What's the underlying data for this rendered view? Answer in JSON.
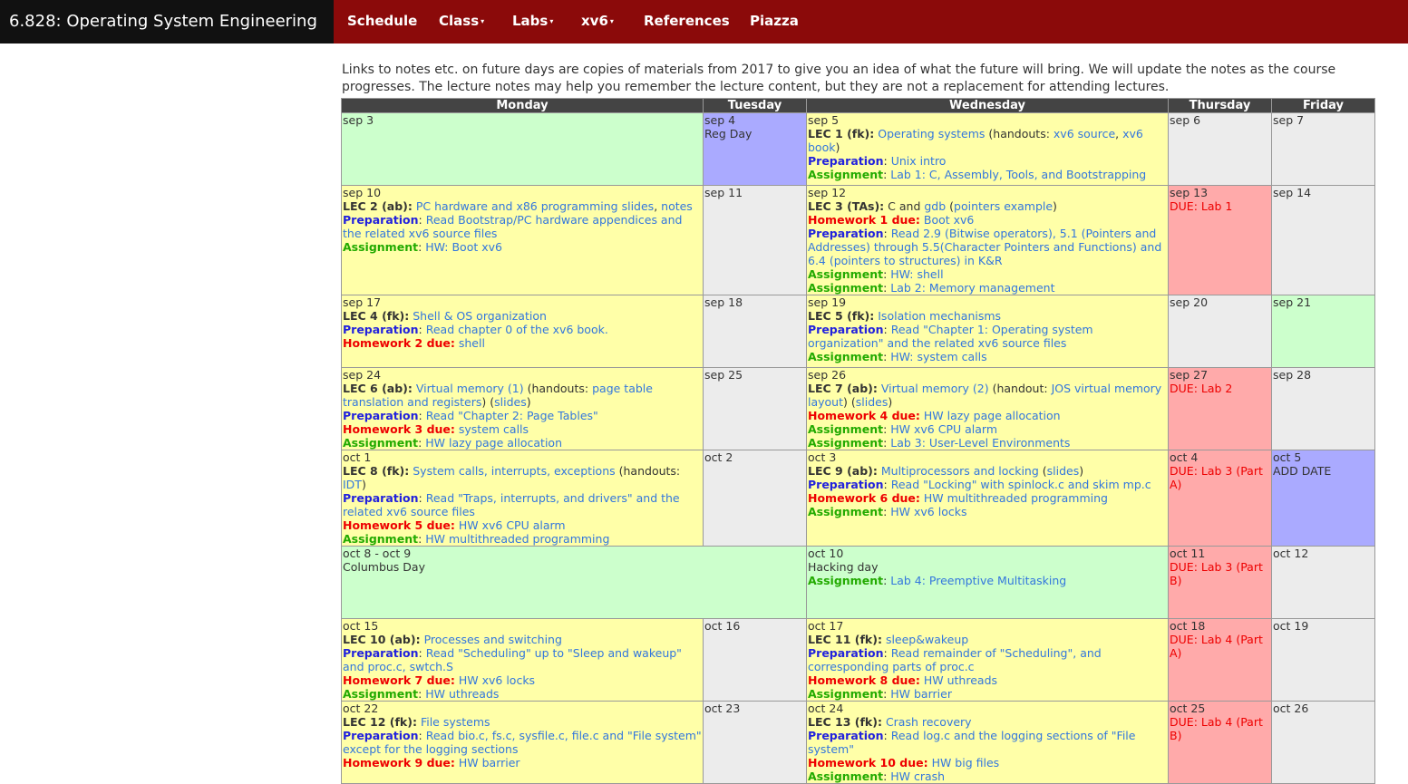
{
  "nav": {
    "brand": "6.828: Operating System Engineering",
    "schedule": "Schedule",
    "class": "Class",
    "labs": "Labs",
    "xv6": "xv6",
    "references": "References",
    "piazza": "Piazza",
    "caret": "▾"
  },
  "intro": "Links to notes etc. on future days are copies of materials from 2017 to give you an idea of what the future will bring. We will update the notes as the course progresses. The lecture notes may help you remember the lecture content, but they are not a replacement for attending lectures.",
  "days": {
    "mon": "Monday",
    "tue": "Tuesday",
    "wed": "Wednesday",
    "thu": "Thursday",
    "fri": "Friday"
  },
  "labels": {
    "preparation": "Preparation",
    "assignment": "Assignment",
    "due": "DUE"
  },
  "colors": {
    "navbar": "#8b0a0a",
    "brand_bg": "#111111",
    "yellow": "#ffffa8",
    "gray": "#ececec",
    "green": "#ccffcc",
    "red": "#ffaaaa",
    "purple": "#aaaaff",
    "link": "#3377dd",
    "prep": "#2222dd",
    "homework": "#ee0000",
    "assignment": "#22aa00"
  },
  "w1": {
    "mon_date": "sep 3",
    "tue_date": "sep 4",
    "tue_note": "Reg Day",
    "wed_date": "sep 5",
    "wed_lec": "LEC 1 (fk):",
    "wed_lec_link": "Operating systems",
    "wed_lec_mid": "(handouts:",
    "wed_lec_link2": "xv6 source",
    "wed_lec_link3": "xv6 book",
    "wed_lec_end": ")",
    "wed_prep": "Unix intro",
    "wed_asg": "Lab 1: C, Assembly, Tools, and Bootstrapping",
    "thu_date": "sep 6",
    "fri_date": "sep 7"
  },
  "w2": {
    "mon_date": "sep 10",
    "mon_lec": "LEC 2 (ab):",
    "mon_lec_link": "PC hardware and x86 programming",
    "mon_lec_link2": "slides",
    "mon_lec_link3": "notes",
    "mon_prep": "Read Bootstrap/PC hardware appendices and the related xv6 source files",
    "mon_asg": "HW: Boot xv6",
    "tue_date": "sep 11",
    "wed_date": "sep 12",
    "wed_lec": "LEC 3 (TAs):",
    "wed_lec_text": "C and",
    "wed_lec_link": "gdb",
    "wed_lec_link2": "pointers example",
    "wed_hw_label": "Homework 1 due:",
    "wed_hw": "Boot xv6",
    "wed_prep": "Read 2.9 (Bitwise operators), 5.1 (Pointers and Addresses) through 5.5(Character Pointers and Functions) and 6.4 (pointers to structures) in K&R",
    "wed_asg": "HW: shell",
    "wed_asg2": "Lab 2: Memory management",
    "thu_date": "sep 13",
    "thu_due": "Lab 1",
    "fri_date": "sep 14"
  },
  "w3": {
    "mon_date": "sep 17",
    "mon_lec": "LEC 4 (fk):",
    "mon_lec_link": "Shell & OS organization",
    "mon_prep": "Read chapter 0 of the xv6 book.",
    "mon_hw_label": "Homework 2 due:",
    "mon_hw": "shell",
    "tue_date": "sep 18",
    "wed_date": "sep 19",
    "wed_lec": "LEC 5 (fk):",
    "wed_lec_link": "Isolation mechanisms",
    "wed_prep": "Read \"Chapter 1: Operating system organization\" and the related xv6 source files",
    "wed_asg": "HW: system calls",
    "thu_date": "sep 20",
    "fri_date": "sep 21"
  },
  "w4": {
    "mon_date": "sep 24",
    "mon_lec": "LEC 6 (ab):",
    "mon_lec_link": "Virtual memory (1)",
    "mon_lec_mid": "(handouts:",
    "mon_lec_link2": "page table translation and registers",
    "mon_lec_link3": "slides",
    "mon_prep": "Read \"Chapter 2: Page Tables\"",
    "mon_hw_label": "Homework 3 due:",
    "mon_hw": "system calls",
    "mon_asg": "HW lazy page allocation",
    "tue_date": "sep 25",
    "wed_date": "sep 26",
    "wed_lec": "LEC 7 (ab):",
    "wed_lec_link": "Virtual memory (2)",
    "wed_lec_mid": "(handout:",
    "wed_lec_link2": "JOS virtual memory layout",
    "wed_lec_link3": "slides",
    "wed_hw_label": "Homework 4 due:",
    "wed_hw": "HW lazy page allocation",
    "wed_asg": "HW xv6 CPU alarm",
    "wed_asg2": "Lab 3: User-Level Environments",
    "thu_date": "sep 27",
    "thu_due": "Lab 2",
    "fri_date": "sep 28"
  },
  "w5": {
    "mon_date": "oct 1",
    "mon_lec": "LEC 8 (fk):",
    "mon_lec_link": "System calls, interrupts, exceptions",
    "mon_lec_mid": "(handouts:",
    "mon_lec_link2": "IDT",
    "mon_prep": "Read \"Traps, interrupts, and drivers\" and the related xv6 source files",
    "mon_hw_label": "Homework 5 due:",
    "mon_hw": "HW xv6 CPU alarm",
    "mon_asg": "HW multithreaded programming",
    "tue_date": "oct 2",
    "wed_date": "oct 3",
    "wed_lec": "LEC 9 (ab):",
    "wed_lec_link": "Multiprocessors and locking",
    "wed_lec_link2": "slides",
    "wed_prep": "Read \"Locking\" with spinlock.c and skim mp.c",
    "wed_hw_label": "Homework 6 due:",
    "wed_hw": "HW multithreaded programming",
    "wed_asg": "HW xv6 locks",
    "thu_date": "oct 4",
    "thu_due": "Lab 3 (Part A)",
    "fri_date": "oct 5",
    "fri_note": "ADD DATE"
  },
  "w6": {
    "mon_date": "oct 8 - oct 9",
    "mon_note": "Columbus Day",
    "wed_date": "oct 10",
    "wed_note": "Hacking day",
    "wed_asg": "Lab 4: Preemptive Multitasking",
    "thu_date": "oct 11",
    "thu_due": "Lab 3 (Part B)",
    "fri_date": "oct 12"
  },
  "w7": {
    "mon_date": "oct 15",
    "mon_lec": "LEC 10 (ab):",
    "mon_lec_link": "Processes and switching",
    "mon_prep": "Read \"Scheduling\" up to \"Sleep and wakeup\" and proc.c, swtch.S",
    "mon_hw_label": "Homework 7 due:",
    "mon_hw": "HW xv6 locks",
    "mon_asg": "HW uthreads",
    "tue_date": "oct 16",
    "wed_date": "oct 17",
    "wed_lec": "LEC 11 (fk):",
    "wed_lec_link": "sleep&wakeup",
    "wed_prep": "Read remainder of \"Scheduling\", and corresponding parts of proc.c",
    "wed_hw_label": "Homework 8 due:",
    "wed_hw": "HW uthreads",
    "wed_asg": "HW barrier",
    "thu_date": "oct 18",
    "thu_due": "Lab 4 (Part A)",
    "fri_date": "oct 19"
  },
  "w8": {
    "mon_date": "oct 22",
    "mon_lec": "LEC 12 (fk):",
    "mon_lec_link": "File systems",
    "mon_prep": "Read bio.c, fs.c, sysfile.c, file.c and \"File system\" except for the logging sections",
    "mon_hw_label": "Homework 9 due:",
    "mon_hw": "HW barrier",
    "tue_date": "oct 23",
    "wed_date": "oct 24",
    "wed_lec": "LEC 13 (fk):",
    "wed_lec_link": "Crash recovery",
    "wed_prep": "Read log.c and the logging sections of \"File system\"",
    "wed_hw_label": "Homework 10 due:",
    "wed_hw": "HW big files",
    "wed_asg": "HW crash",
    "thu_date": "oct 25",
    "thu_due": "Lab 4 (Part B)",
    "fri_date": "oct 26"
  }
}
